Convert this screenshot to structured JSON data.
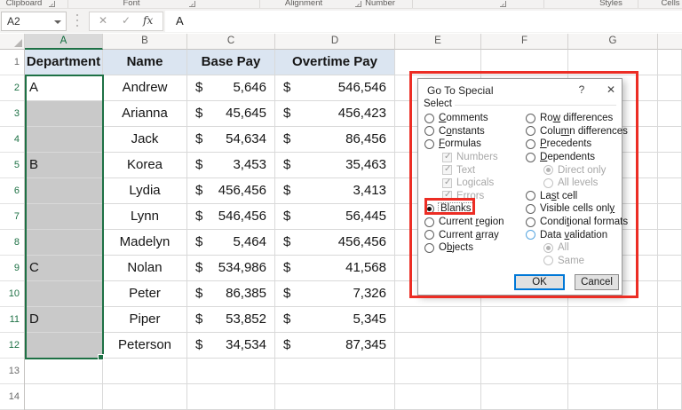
{
  "ribbon": {
    "groups": [
      "Clipboard",
      "Font",
      "Alignment",
      "Number",
      "Styles",
      "Cells"
    ]
  },
  "formula_bar": {
    "name_box": "A2",
    "content": "A",
    "cancel_icon": "✕",
    "enter_icon": "✓",
    "fx_label": "fx"
  },
  "sheet": {
    "columns": [
      "A",
      "B",
      "C",
      "D",
      "E",
      "F",
      "G"
    ],
    "headers": {
      "dept": "Department",
      "name": "Name",
      "base": "Base Pay",
      "ot": "Overtime Pay"
    },
    "currency": "$",
    "row_numbers": [
      "1",
      "2",
      "3",
      "4",
      "5",
      "6",
      "7",
      "8",
      "9",
      "10",
      "11",
      "12",
      "13",
      "14"
    ],
    "selected_range": "A2:A12",
    "rows": [
      {
        "dept": "A",
        "name": "Andrew",
        "base": "5,646",
        "ot": "546,546"
      },
      {
        "dept": "",
        "name": "Arianna",
        "base": "45,645",
        "ot": "456,423"
      },
      {
        "dept": "",
        "name": "Jack",
        "base": "54,634",
        "ot": "86,456"
      },
      {
        "dept": "B",
        "name": "Korea",
        "base": "3,453",
        "ot": "35,463"
      },
      {
        "dept": "",
        "name": "Lydia",
        "base": "456,456",
        "ot": "3,413"
      },
      {
        "dept": "",
        "name": "Lynn",
        "base": "546,456",
        "ot": "56,445"
      },
      {
        "dept": "",
        "name": "Madelyn",
        "base": "5,464",
        "ot": "456,456"
      },
      {
        "dept": "C",
        "name": "Nolan",
        "base": "534,986",
        "ot": "41,568"
      },
      {
        "dept": "",
        "name": "Peter",
        "base": "86,385",
        "ot": "7,326"
      },
      {
        "dept": "D",
        "name": "Piper",
        "base": "53,852",
        "ot": "5,345"
      },
      {
        "dept": "",
        "name": "Peterson",
        "base": "34,534",
        "ot": "87,345"
      }
    ]
  },
  "dialog": {
    "title": "Go To Special",
    "help_icon": "?",
    "close_icon": "✕",
    "group_label": "Select",
    "ok_label": "OK",
    "cancel_label": "Cancel",
    "left_options": [
      {
        "pre": "",
        "key": "C",
        "post": "omments",
        "cls": ""
      },
      {
        "pre": "C",
        "key": "o",
        "post": "nstants",
        "cls": ""
      },
      {
        "pre": "",
        "key": "F",
        "post": "ormulas",
        "cls": ""
      },
      {
        "pre": "Numbers",
        "key": "",
        "post": "",
        "cls": "sub chk dis"
      },
      {
        "pre": "Text",
        "key": "",
        "post": "",
        "cls": "sub chk dis"
      },
      {
        "pre": "Logicals",
        "key": "",
        "post": "",
        "cls": "sub chk dis"
      },
      {
        "pre": "Errors",
        "key": "",
        "post": "",
        "cls": "sub chk dis"
      },
      {
        "pre": "Blan",
        "key": "k",
        "post": "s",
        "cls": "on focus"
      },
      {
        "pre": "Current ",
        "key": "r",
        "post": "egion",
        "cls": ""
      },
      {
        "pre": "Current ",
        "key": "a",
        "post": "rray",
        "cls": ""
      },
      {
        "pre": "O",
        "key": "b",
        "post": "jects",
        "cls": ""
      }
    ],
    "right_options": [
      {
        "pre": "Ro",
        "key": "w",
        "post": " differences",
        "cls": ""
      },
      {
        "pre": "Colu",
        "key": "m",
        "post": "n differences",
        "cls": ""
      },
      {
        "pre": "",
        "key": "P",
        "post": "recedents",
        "cls": ""
      },
      {
        "pre": "",
        "key": "D",
        "post": "ependents",
        "cls": ""
      },
      {
        "pre": "Direct only",
        "key": "",
        "post": "",
        "cls": "sub dis dison"
      },
      {
        "pre": "All levels",
        "key": "",
        "post": "",
        "cls": "sub dis"
      },
      {
        "pre": "La",
        "key": "s",
        "post": "t cell",
        "cls": ""
      },
      {
        "pre": "Visible cells onl",
        "key": "y",
        "post": "",
        "cls": ""
      },
      {
        "pre": "Condi",
        "key": "t",
        "post": "ional formats",
        "cls": ""
      },
      {
        "pre": "Data ",
        "key": "v",
        "post": "alidation",
        "cls": "blue"
      },
      {
        "pre": "All",
        "key": "",
        "post": "",
        "cls": "sub dis dison"
      },
      {
        "pre": "Same",
        "key": "",
        "post": "",
        "cls": "sub dis"
      }
    ]
  },
  "colors": {
    "accent_green": "#1e7145",
    "selection_gray": "#c9c9c9",
    "header_blue": "#dbe5f1",
    "annotation_red": "#ec2d24",
    "default_button_blue": "#0078d7"
  }
}
